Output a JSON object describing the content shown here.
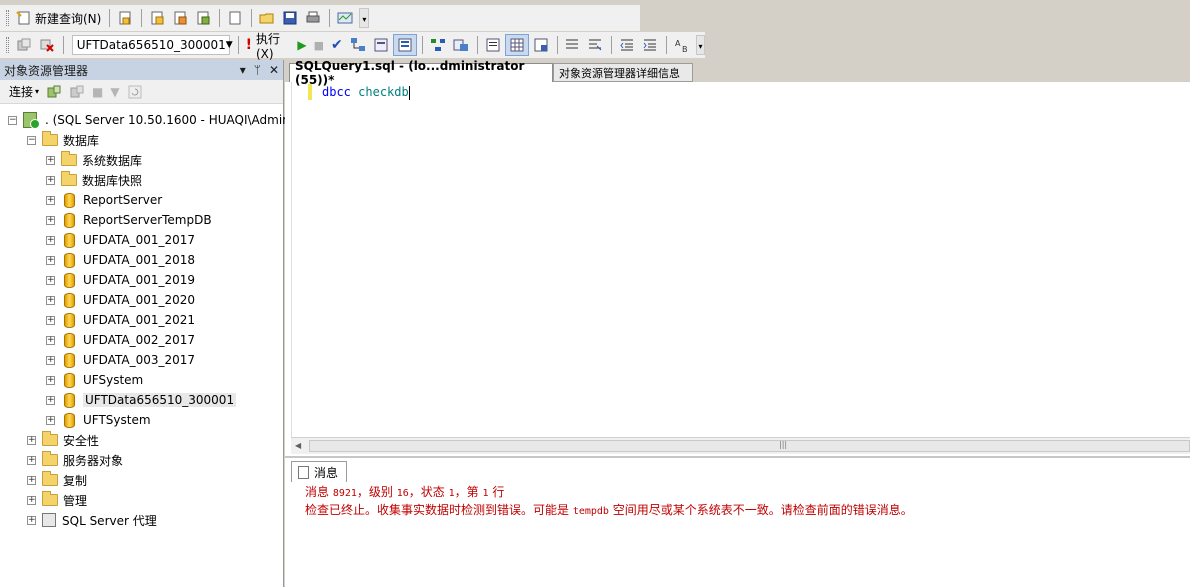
{
  "toolbar1": {
    "new_query_label": "新建查询(N)",
    "icons": [
      "new-query-icon",
      "database-query-icon",
      "mdx-query-icon",
      "dmx-query-icon",
      "xmla-query-icon",
      "new-file-icon",
      "open-file-icon",
      "save-icon",
      "print-icon",
      "activity-monitor-icon"
    ]
  },
  "toolbar2": {
    "database": "UFTData656510_300001",
    "execute_label": "执行(X)"
  },
  "object_explorer": {
    "title": "对象资源管理器",
    "connect_label": "连接",
    "server_node": ". (SQL Server 10.50.1600 - HUAQI\\Admini",
    "databases_label": "数据库",
    "database_children": [
      {
        "label": "系统数据库",
        "kind": "folder"
      },
      {
        "label": "数据库快照",
        "kind": "folder"
      },
      {
        "label": "ReportServer",
        "kind": "db"
      },
      {
        "label": "ReportServerTempDB",
        "kind": "db"
      },
      {
        "label": "UFDATA_001_2017",
        "kind": "db"
      },
      {
        "label": "UFDATA_001_2018",
        "kind": "db"
      },
      {
        "label": "UFDATA_001_2019",
        "kind": "db"
      },
      {
        "label": "UFDATA_001_2020",
        "kind": "db"
      },
      {
        "label": "UFDATA_001_2021",
        "kind": "db"
      },
      {
        "label": "UFDATA_002_2017",
        "kind": "db"
      },
      {
        "label": "UFDATA_003_2017",
        "kind": "db"
      },
      {
        "label": "UFSystem",
        "kind": "db"
      },
      {
        "label": "UFTData656510_300001",
        "kind": "db",
        "selected": true
      },
      {
        "label": "UFTSystem",
        "kind": "db"
      }
    ],
    "server_children": [
      {
        "label": "安全性",
        "kind": "folder"
      },
      {
        "label": "服务器对象",
        "kind": "folder"
      },
      {
        "label": "复制",
        "kind": "folder"
      },
      {
        "label": "管理",
        "kind": "folder"
      },
      {
        "label": "SQL Server 代理",
        "kind": "agent"
      }
    ]
  },
  "editor": {
    "tabs": [
      "SQLQuery1.sql - (lo...dministrator (55))*",
      "对象资源管理器详细信息"
    ],
    "code_keyword": "dbcc",
    "code_rest": "checkdb"
  },
  "results": {
    "tab_label": "消息",
    "line1_prefix": "消息 ",
    "line1_msgno": "8921",
    "line1_a": "，级别 ",
    "line1_level": "16",
    "line1_b": "，状态 ",
    "line1_state": "1",
    "line1_c": "，第 ",
    "line1_line": "1",
    "line1_d": " 行",
    "line2_a": "检查已终止。收集事实数据时检测到错误。可能是 ",
    "line2_db": "tempdb",
    "line2_b": " 空间用尽或某个系统表不一致。请检查前面的错误消息。"
  }
}
